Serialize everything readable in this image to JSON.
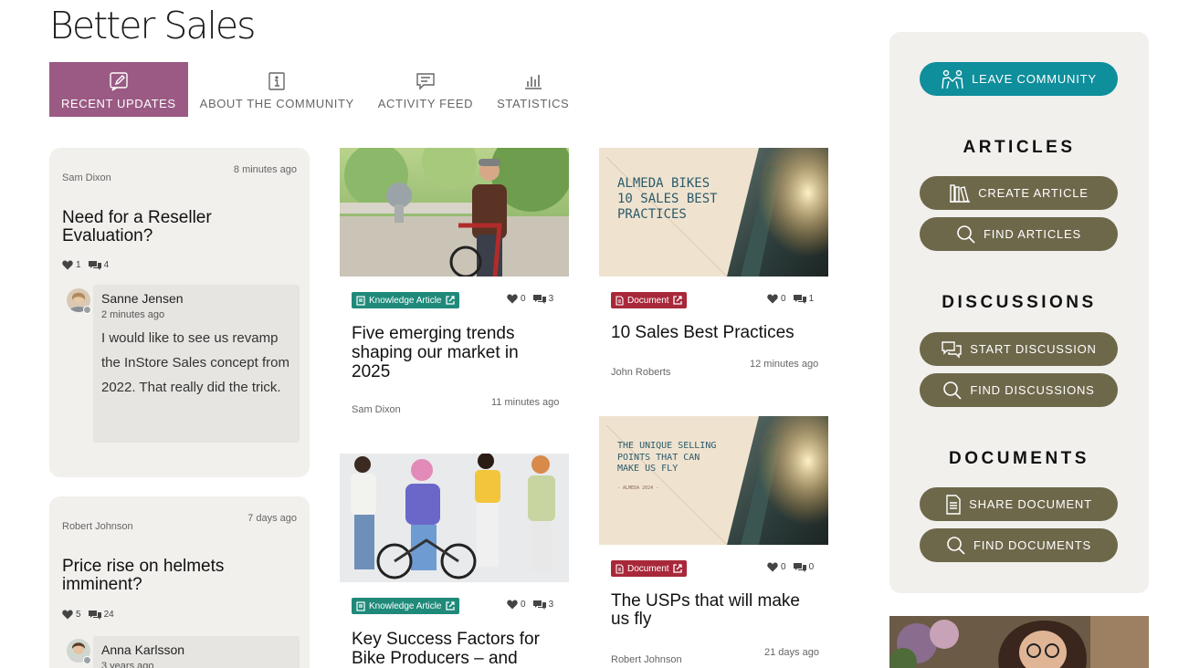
{
  "app_title": "Better Sales",
  "tabs": [
    {
      "label": "RECENT UPDATES",
      "icon": "edit-icon"
    },
    {
      "label": "ABOUT THE COMMUNITY",
      "icon": "info-icon"
    },
    {
      "label": "ACTIVITY FEED",
      "icon": "chat-icon"
    },
    {
      "label": "STATISTICS",
      "icon": "bar-chart-icon"
    }
  ],
  "discussions": [
    {
      "author": "Sam Dixon",
      "time": "8 minutes ago",
      "title": "Need for a Reseller Evaluation?",
      "likes": "1",
      "comments": "4",
      "reply": {
        "name": "Sanne Jensen",
        "time": "2 minutes ago",
        "text": "I would like to see us revamp the InStore Sales concept from 2022. That really did the trick."
      }
    },
    {
      "author": "Robert Johnson",
      "time": "7 days ago",
      "title": "Price rise on helmets imminent?",
      "likes": "5",
      "comments": "24",
      "reply": {
        "name": "Anna Karlsson",
        "time": "3 years ago"
      }
    }
  ],
  "articles": [
    {
      "tag": "Knowledge Article",
      "likes": "0",
      "comments": "3",
      "title": "Five emerging trends shaping our market in 2025",
      "author": "Sam Dixon",
      "time": "11 minutes ago"
    },
    {
      "tag": "Knowledge Article",
      "likes": "0",
      "comments": "3",
      "title": "Key Success Factors for Bike Producers – and"
    }
  ],
  "documents": [
    {
      "tag": "Document",
      "likes": "0",
      "comments": "1",
      "title": "10 Sales Best Practices",
      "author": "John Roberts",
      "time": "12 minutes ago",
      "cover_lines": [
        "ALMEDA BIKES",
        "10 SALES BEST",
        "PRACTICES"
      ]
    },
    {
      "tag": "Document",
      "likes": "0",
      "comments": "0",
      "title": "The USPs that will make us fly",
      "author": "Robert Johnson",
      "time": "21 days ago",
      "cover_lines": [
        "THE UNIQUE SELLING",
        "POINTS THAT CAN",
        "MAKE US FLY"
      ],
      "cover_small": "- ALMEDA 2024 -"
    }
  ],
  "sidebar": {
    "leave_label": "LEAVE COMMUNITY",
    "articles_heading": "ARTICLES",
    "create_article": "CREATE ARTICLE",
    "find_articles": "FIND ARTICLES",
    "discussions_heading": "DISCUSSIONS",
    "start_discussion": "START DISCUSSION",
    "find_discussions": "FIND DISCUSSIONS",
    "documents_heading": "DOCUMENTS",
    "share_document": "SHARE DOCUMENT",
    "find_documents": "FIND DOCUMENTS"
  },
  "colors": {
    "active_tab": "#9a5a84",
    "teal_button": "#0f8e9c",
    "olive_button": "#6e684b",
    "knowledge_tag": "#1f8a7a",
    "document_tag": "#a8283a",
    "card_bg": "#f1f0ed"
  }
}
